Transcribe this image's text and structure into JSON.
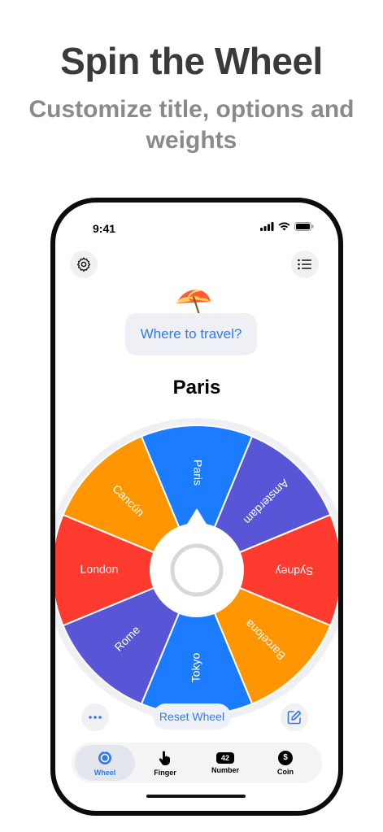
{
  "promo": {
    "headline": "Spin the Wheel",
    "subline": "Customize title, options and weights"
  },
  "status_bar": {
    "time": "9:41",
    "icons": [
      "signal-icon",
      "wifi-icon",
      "battery-icon"
    ]
  },
  "header": {
    "settings_icon": "gear-icon",
    "list_icon": "list-icon"
  },
  "wheel_title": {
    "emoji": "umbrella-icon",
    "text": "Where to travel?"
  },
  "result": "Paris",
  "wheel": {
    "segments": [
      {
        "label": "Paris",
        "color": "#1b7cff"
      },
      {
        "label": "Amsterdam",
        "color": "#5856d6"
      },
      {
        "label": "Sydney",
        "color": "#ff3b30"
      },
      {
        "label": "Barcelona",
        "color": "#ff9500"
      },
      {
        "label": "Tokyo",
        "color": "#1b7cff"
      },
      {
        "label": "Rome",
        "color": "#5856d6"
      },
      {
        "label": "London",
        "color": "#ff3b30"
      },
      {
        "label": "Cancún",
        "color": "#ff9500"
      }
    ]
  },
  "controls": {
    "more_icon": "ellipsis-icon",
    "reset_label": "Reset Wheel",
    "edit_icon": "edit-icon"
  },
  "tabs": [
    {
      "label": "Wheel",
      "icon": "wheel-icon",
      "active": true
    },
    {
      "label": "Finger",
      "icon": "finger-icon",
      "active": false
    },
    {
      "label": "Number",
      "icon": "number-icon",
      "badge": "42",
      "active": false
    },
    {
      "label": "Coin",
      "icon": "coin-icon",
      "badge": "$",
      "active": false
    }
  ],
  "colors": {
    "accent": "#2f7bf0",
    "headline": "#3a3a3a",
    "subline": "#8a8a8a"
  }
}
